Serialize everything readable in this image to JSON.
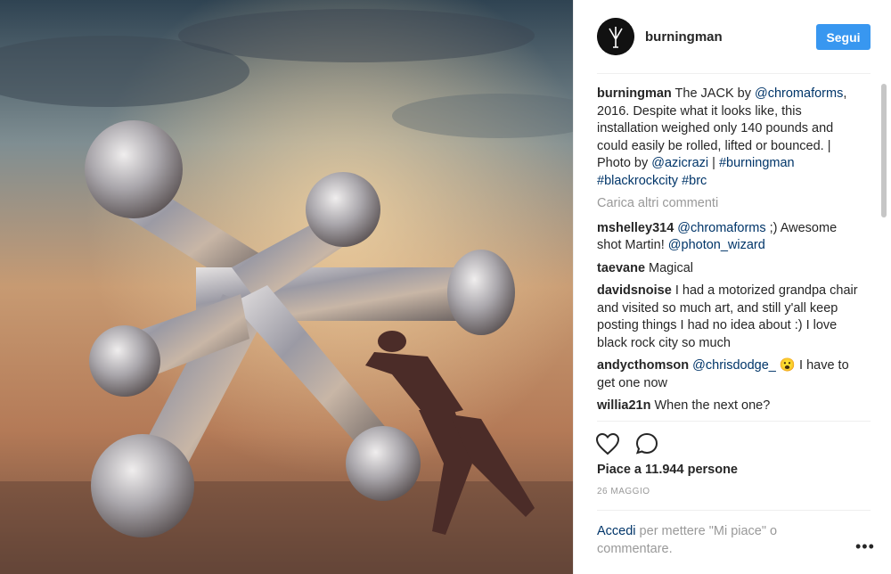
{
  "post": {
    "username": "burningman",
    "follow_label": "Segui",
    "caption": {
      "user": "burningman",
      "t1": " The JACK by ",
      "m1": "@chromaforms",
      "t2": ", 2016. Despite what it looks like, this installation weighed only 140 pounds and could easily be rolled, lifted or bounced. | Photo by ",
      "m2": "@azicrazi",
      "t3": " | ",
      "h1": "#burningman",
      "h2": "#blackrockcity",
      "h3": "#brc"
    },
    "load_more": "Carica altri commenti",
    "comments": [
      {
        "user": "mshelley314",
        "m": "@chromaforms",
        "text": " ;) Awesome shot Martin! ",
        "m2": "@photon_wizard"
      },
      {
        "user": "taevane",
        "text": " Magical"
      },
      {
        "user": "davidsnoise",
        "text": " I had a motorized grandpa chair and visited so much art, and still y'all keep posting things I had no idea about :) I love black rock city so much"
      },
      {
        "user": "andycthomson",
        "m": "@chrisdodge_",
        "emoji": "😮",
        "text": " I have to get one now"
      },
      {
        "user": "willia21n",
        "text": " When the next one?"
      }
    ],
    "likes": "Piace a 11.944 persone",
    "date": "26 MAGGIO",
    "login_link": "Accedi",
    "login_text": " per mettere \"Mi piace\" o commentare.",
    "more_icon": "more-horizontal-icon"
  }
}
